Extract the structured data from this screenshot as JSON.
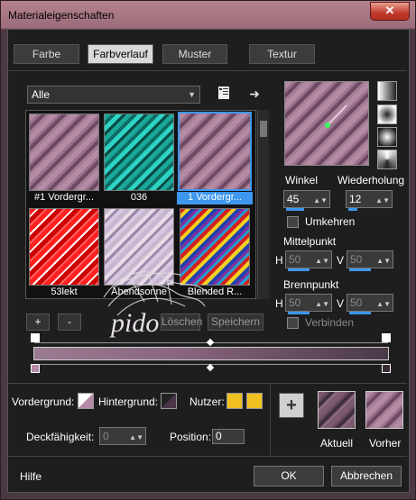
{
  "window": {
    "title": "Materialeigenschaften",
    "close_glyph": "✕"
  },
  "tabs": [
    {
      "label": "Farbe"
    },
    {
      "label": "Farbverlauf"
    },
    {
      "label": "Muster"
    },
    {
      "label": "Textur"
    }
  ],
  "filter": {
    "selected": "Alle"
  },
  "gallery": {
    "items": [
      {
        "label": "#1 Vordergr...",
        "selected": false
      },
      {
        "label": "036",
        "selected": false
      },
      {
        "label": "1 Vordergr...",
        "selected": true
      },
      {
        "label": "53lekt",
        "selected": false
      },
      {
        "label": "Abendsonne",
        "selected": false
      },
      {
        "label": "Blended R...",
        "selected": false
      }
    ],
    "add_label": "+",
    "remove_label": "-",
    "delete_label": "Löschen",
    "save_label": "Speichern"
  },
  "angle": {
    "label": "Winkel",
    "value": "45"
  },
  "repeat": {
    "label": "Wiederholung",
    "value": "12"
  },
  "invert": {
    "label": "Umkehren"
  },
  "center": {
    "label": "Mittelpunkt",
    "h_label": "H",
    "h_value": "50",
    "v_label": "V",
    "v_value": "50"
  },
  "focus": {
    "label": "Brennpunkt",
    "h_label": "H",
    "h_value": "50",
    "v_label": "V",
    "v_value": "50"
  },
  "link": {
    "label": "Verbinden"
  },
  "bottom": {
    "foreground_label": "Vordergrund:",
    "background_label": "Hintergrund:",
    "user_label": "Nutzer:",
    "opacity_label": "Deckfähigkeit:",
    "opacity_value": "0",
    "position_label": "Position:",
    "position_value": "0",
    "add_glyph": "+",
    "current_label": "Aktuell",
    "previous_label": "Vorher"
  },
  "footer": {
    "help_label": "Hilfe",
    "ok_label": "OK",
    "cancel_label": "Abbrechen"
  },
  "watermark": "pido",
  "colors": {
    "accent": "#3d97ee",
    "user_swatch": "#f0c020"
  }
}
